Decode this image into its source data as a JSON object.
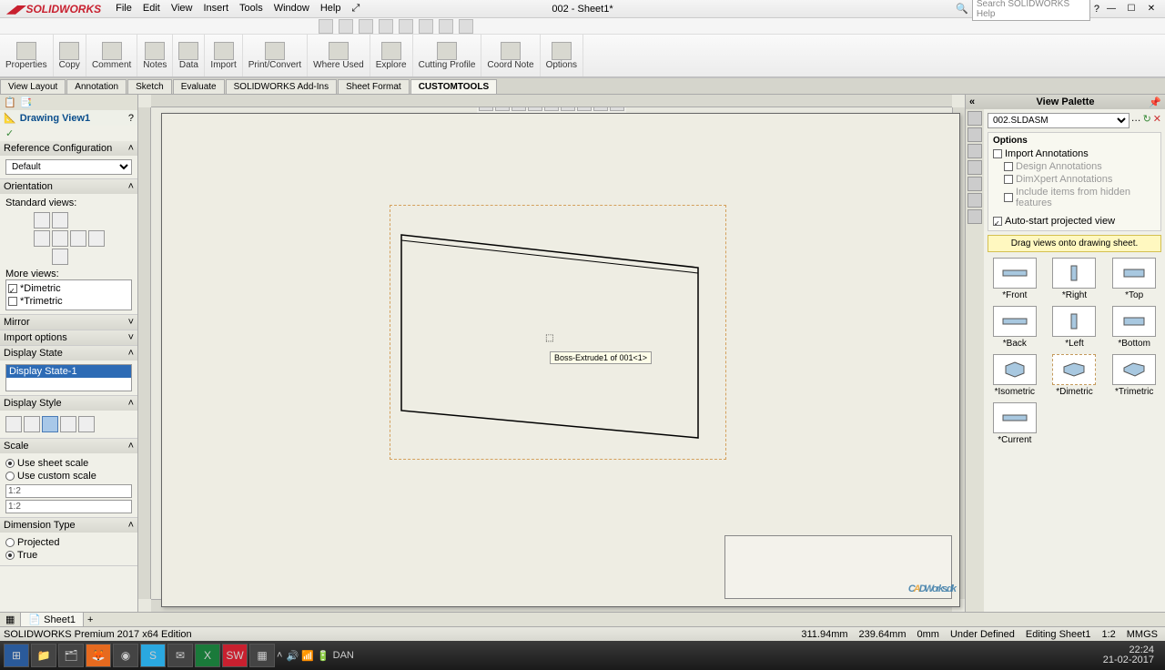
{
  "app": {
    "name": "SOLIDWORKS",
    "title": "002 - Sheet1*"
  },
  "menu": [
    "File",
    "Edit",
    "View",
    "Insert",
    "Tools",
    "Window",
    "Help"
  ],
  "search_placeholder": "Search SOLIDWORKS Help",
  "cmd_groups": [
    {
      "label": "Properties"
    },
    {
      "label": "Copy"
    },
    {
      "label": "Comment"
    },
    {
      "label": "Notes"
    },
    {
      "label": "Data"
    },
    {
      "label": "Import"
    },
    {
      "label": "Print/Convert"
    },
    {
      "label": "Where Used"
    },
    {
      "label": "Explore"
    },
    {
      "label": "Cutting Profile"
    },
    {
      "label": "Coord Note"
    },
    {
      "label": "Options"
    }
  ],
  "tabs": [
    "View Layout",
    "Annotation",
    "Sketch",
    "Evaluate",
    "SOLIDWORKS Add-Ins",
    "Sheet Format",
    "CUSTOMTOOLS"
  ],
  "active_tab": "CUSTOMTOOLS",
  "fm": {
    "title": "Drawing View1",
    "sections": {
      "ref_config": {
        "title": "Reference Configuration",
        "value": "Default"
      },
      "orientation": {
        "title": "Orientation",
        "standard": "Standard views:",
        "more": "More views:",
        "dimetric": "*Dimetric",
        "trimetric": "*Trimetric"
      },
      "mirror": "Mirror",
      "import": "Import options",
      "disp_state": {
        "title": "Display State",
        "value": "Display State-1"
      },
      "disp_style": "Display Style",
      "scale": {
        "title": "Scale",
        "sheet": "Use sheet scale",
        "custom": "Use custom scale",
        "v1": "1:2",
        "v2": "1:2"
      },
      "dim_type": {
        "title": "Dimension Type",
        "proj": "Projected",
        "true": "True"
      }
    }
  },
  "tooltip": "Boss-Extrude1 of 001<1>",
  "rp": {
    "title": "View Palette",
    "model": "002.SLDASM",
    "options": "Options",
    "import_anno": "Import Annotations",
    "design_anno": "Design Annotations",
    "dimxpert": "DimXpert Annotations",
    "hidden": "Include items from hidden features",
    "autostart": "Auto-start projected view",
    "drag": "Drag views onto drawing sheet.",
    "thumbs": [
      "*Front",
      "*Right",
      "*Top",
      "*Back",
      "*Left",
      "*Bottom",
      "*Isometric",
      "*Dimetric",
      "*Trimetric",
      "*Current"
    ]
  },
  "bottom_tab": "Sheet1",
  "status": {
    "edition": "SOLIDWORKS Premium 2017 x64 Edition",
    "x": "311.94mm",
    "y": "239.64mm",
    "z": "0mm",
    "defined": "Under Defined",
    "editing": "Editing Sheet1",
    "scale": "1:2",
    "units": "MMGS"
  },
  "tray": {
    "lang": "DAN",
    "time": "22:24",
    "date": "21-02-2017"
  },
  "watermark": {
    "p1": "C",
    "p2": "A",
    "p3": "DWorks.dk"
  }
}
